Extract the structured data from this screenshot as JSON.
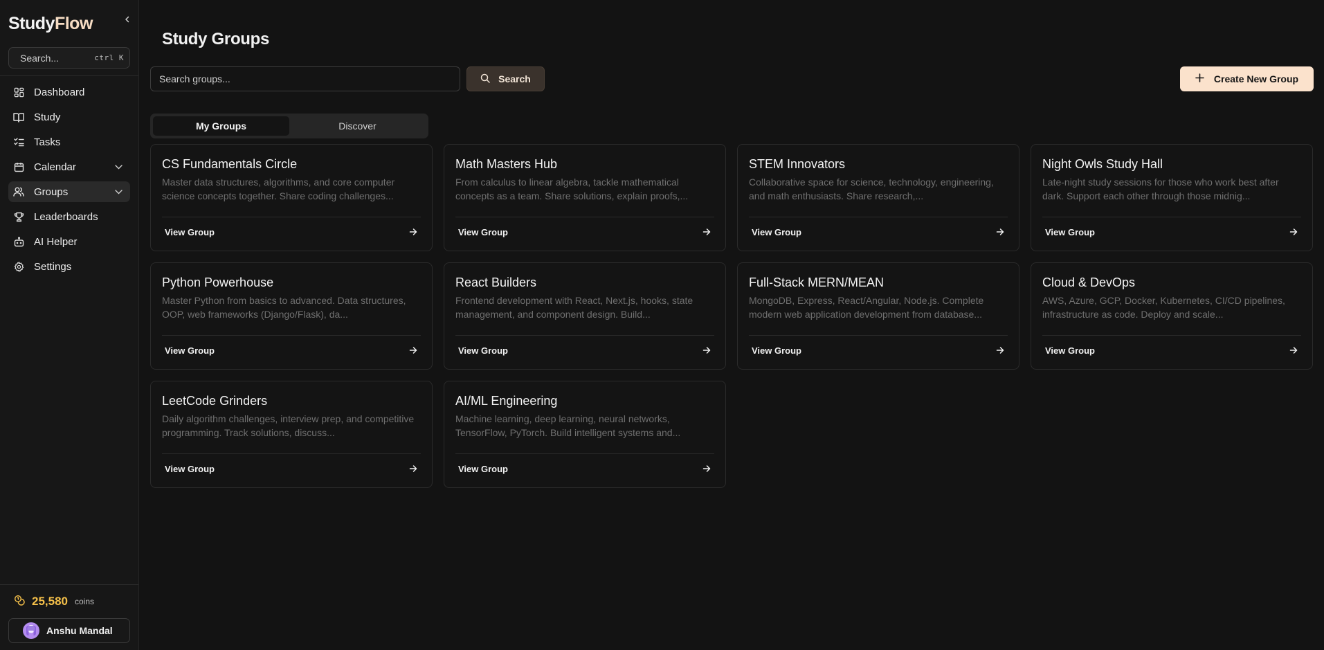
{
  "sidebar": {
    "brand_main": "Study",
    "brand_accent": "Flow",
    "search_placeholder": "Search...",
    "search_shortcut": "ctrl K",
    "items": [
      {
        "label": "Dashboard",
        "icon": "dashboard-icon"
      },
      {
        "label": "Study",
        "icon": "book-icon"
      },
      {
        "label": "Tasks",
        "icon": "tasks-icon"
      },
      {
        "label": "Calendar",
        "icon": "calendar-icon",
        "expandable": true
      },
      {
        "label": "Groups",
        "icon": "users-icon",
        "expandable": true,
        "active": true
      },
      {
        "label": "Leaderboards",
        "icon": "trophy-icon"
      },
      {
        "label": "AI Helper",
        "icon": "bot-icon"
      },
      {
        "label": "Settings",
        "icon": "gear-icon"
      }
    ],
    "coins_amount": "25,580",
    "coins_unit": "coins",
    "user_name": "Anshu Mandal"
  },
  "main": {
    "title": "Study Groups",
    "search_placeholder": "Search groups...",
    "search_button": "Search",
    "create_button": "Create New Group",
    "tabs": [
      {
        "label": "My Groups",
        "active": true
      },
      {
        "label": "Discover",
        "active": false
      }
    ],
    "groups": [
      {
        "title": "CS Fundamentals Circle",
        "desc": "Master data structures, algorithms, and core computer science concepts together. Share coding challenges...",
        "action": "View Group"
      },
      {
        "title": "Math Masters Hub",
        "desc": "From calculus to linear algebra, tackle mathematical concepts as a team. Share solutions, explain proofs,...",
        "action": "View Group"
      },
      {
        "title": "STEM Innovators",
        "desc": "Collaborative space for science, technology, engineering, and math enthusiasts. Share research,...",
        "action": "View Group"
      },
      {
        "title": "Night Owls Study Hall",
        "desc": "Late-night study sessions for those who work best after dark. Support each other through those midnig...",
        "action": "View Group"
      },
      {
        "title": "Python Powerhouse",
        "desc": "Master Python from basics to advanced. Data structures, OOP, web frameworks (Django/Flask), da...",
        "action": "View Group"
      },
      {
        "title": "React Builders",
        "desc": "Frontend development with React, Next.js, hooks, state management, and component design. Build...",
        "action": "View Group"
      },
      {
        "title": "Full-Stack MERN/MEAN",
        "desc": "MongoDB, Express, React/Angular, Node.js. Complete modern web application development from database...",
        "action": "View Group"
      },
      {
        "title": "Cloud & DevOps",
        "desc": "AWS, Azure, GCP, Docker, Kubernetes, CI/CD pipelines, infrastructure as code. Deploy and scale...",
        "action": "View Group"
      },
      {
        "title": "LeetCode Grinders",
        "desc": "Daily algorithm challenges, interview prep, and competitive programming. Track solutions, discuss...",
        "action": "View Group"
      },
      {
        "title": "AI/ML Engineering",
        "desc": "Machine learning, deep learning, neural networks, TensorFlow, PyTorch. Build intelligent systems and...",
        "action": "View Group"
      }
    ]
  }
}
